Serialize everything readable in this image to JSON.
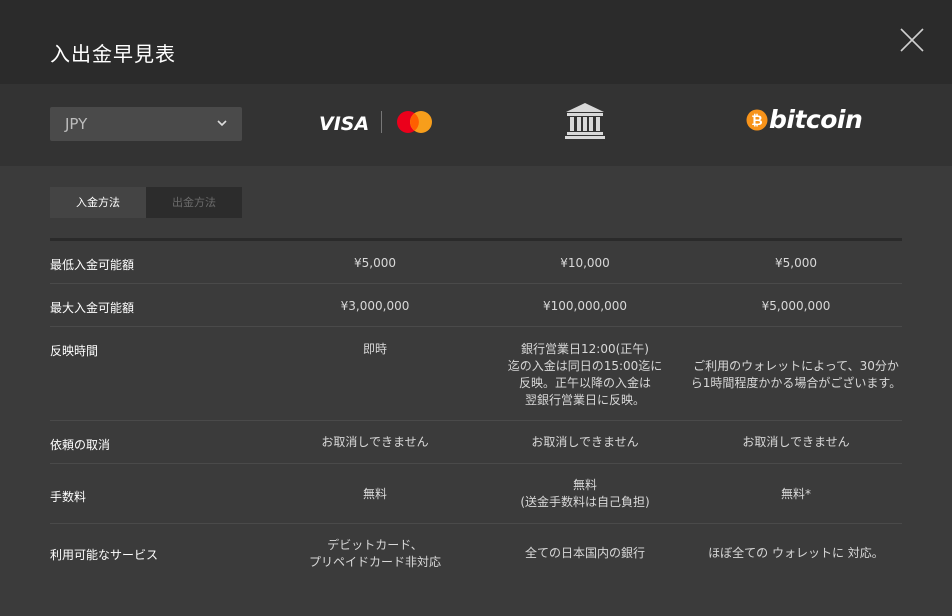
{
  "header": {
    "title": "入出金早見表"
  },
  "currency_select": {
    "value": "JPY"
  },
  "payment_methods": {
    "visa": "VISA",
    "bitcoin": "bitcoin"
  },
  "tabs": [
    {
      "label": "入金方法",
      "active": true
    },
    {
      "label": "出金方法",
      "active": false
    }
  ],
  "table": {
    "rows": [
      {
        "label": "最低入金可能額",
        "values": [
          "¥5,000",
          "¥10,000",
          "¥5,000"
        ]
      },
      {
        "label": "最大入金可能額",
        "values": [
          "¥3,000,000",
          "¥100,000,000",
          "¥5,000,000"
        ]
      },
      {
        "label": "反映時間",
        "values": [
          "即時",
          "銀行営業日12:00(正午)\n迄の入金は同日の15:00迄に\n反映。正午以降の入金は\n翌銀行営業日に反映。",
          "ご利用のウォレットによって、30分か\nら1時間程度かかる場合がございます。"
        ]
      },
      {
        "label": "依頼の取消",
        "values": [
          "お取消しできません",
          "お取消しできません",
          "お取消しできません"
        ]
      },
      {
        "label": "手数料",
        "values": [
          "無料",
          "無料\n(送金手数料は自己負担)",
          "無料*"
        ]
      },
      {
        "label": "利用可能なサービス",
        "values": [
          "デビットカード、\nプリペイドカード非対応",
          "全ての日本国内の銀行",
          "ほぼ全ての ウォレットに 対応。"
        ]
      }
    ]
  },
  "colors": {
    "background": "#3b3b3b",
    "header": "#2b2b2b",
    "bitcoin_orange": "#f7931a",
    "mastercard_red": "#eb001b",
    "mastercard_orange": "#f79e1b"
  }
}
